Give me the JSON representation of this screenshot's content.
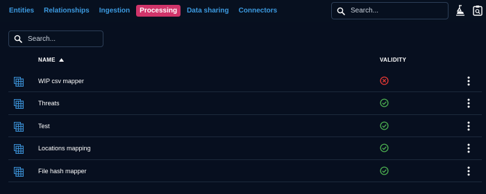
{
  "nav": {
    "tabs": [
      {
        "label": "Entities"
      },
      {
        "label": "Relationships"
      },
      {
        "label": "Ingestion"
      },
      {
        "label": "Processing"
      },
      {
        "label": "Data sharing"
      },
      {
        "label": "Connectors"
      }
    ],
    "active_tab": "Processing",
    "search_placeholder": "Search...",
    "icons": [
      "lab-flask-icon",
      "clipboard-search-icon"
    ]
  },
  "list": {
    "search_placeholder": "Search...",
    "columns": {
      "name": "NAME",
      "validity": "VALIDITY"
    },
    "sort": "ascending",
    "rows": [
      {
        "name": "WIP csv mapper",
        "valid": false
      },
      {
        "name": "Threats",
        "valid": true
      },
      {
        "name": "Test",
        "valid": true
      },
      {
        "name": "Locations mapping",
        "valid": true
      },
      {
        "name": "File hash mapper",
        "valid": true
      }
    ]
  },
  "colors": {
    "background": "#070f1f",
    "accent": "#3c9ae0",
    "active_tab": "#d0346a",
    "valid": "#4caf50",
    "invalid": "#e53935",
    "row_icon": "#3a8fd4"
  }
}
